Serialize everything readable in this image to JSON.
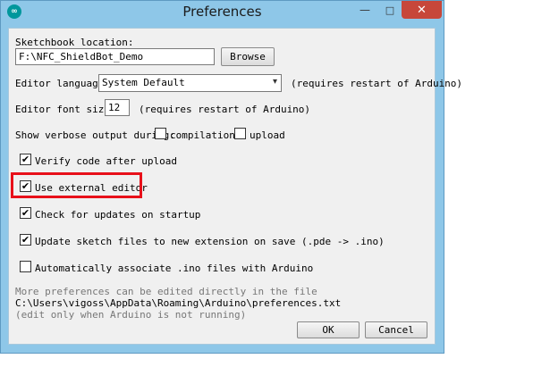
{
  "window": {
    "title": "Preferences",
    "app_icon": "∞",
    "minimize_glyph": "—",
    "maximize_glyph": "□",
    "close_glyph": "✕"
  },
  "sketchbook": {
    "label": "Sketchbook location:",
    "value": "F:\\NFC_ShieldBot_Demo",
    "browse_label": "Browse"
  },
  "editor_language": {
    "label": "Editor language:",
    "selected": "System Default",
    "note": "(requires restart of Arduino)"
  },
  "font_size": {
    "label": "Editor font size:",
    "value": "12",
    "note": "(requires restart of Arduino)"
  },
  "verbose": {
    "label": "Show verbose output during:",
    "compilation_label": "compilation",
    "compilation_checked": false,
    "upload_label": "upload",
    "upload_checked": false
  },
  "options": [
    {
      "label": "Verify code after upload",
      "checked": true
    },
    {
      "label": "Use external editor",
      "checked": true
    },
    {
      "label": "Check for updates on startup",
      "checked": true
    },
    {
      "label": "Update sketch files to new extension on save (.pde -> .ino)",
      "checked": true
    },
    {
      "label": "Automatically associate .ino files with Arduino",
      "checked": false
    }
  ],
  "footer": {
    "more_prefs": "More preferences can be edited directly in the file",
    "path": "C:\\Users\\vigoss\\AppData\\Roaming\\Arduino\\preferences.txt",
    "edit_note": "(edit only when Arduino is not running)"
  },
  "buttons": {
    "ok": "OK",
    "cancel": "Cancel"
  },
  "colors": {
    "window_frame": "#8ec7e8",
    "close_button": "#c7473a",
    "highlight": "#e8101a"
  },
  "check_glyph": "✔"
}
